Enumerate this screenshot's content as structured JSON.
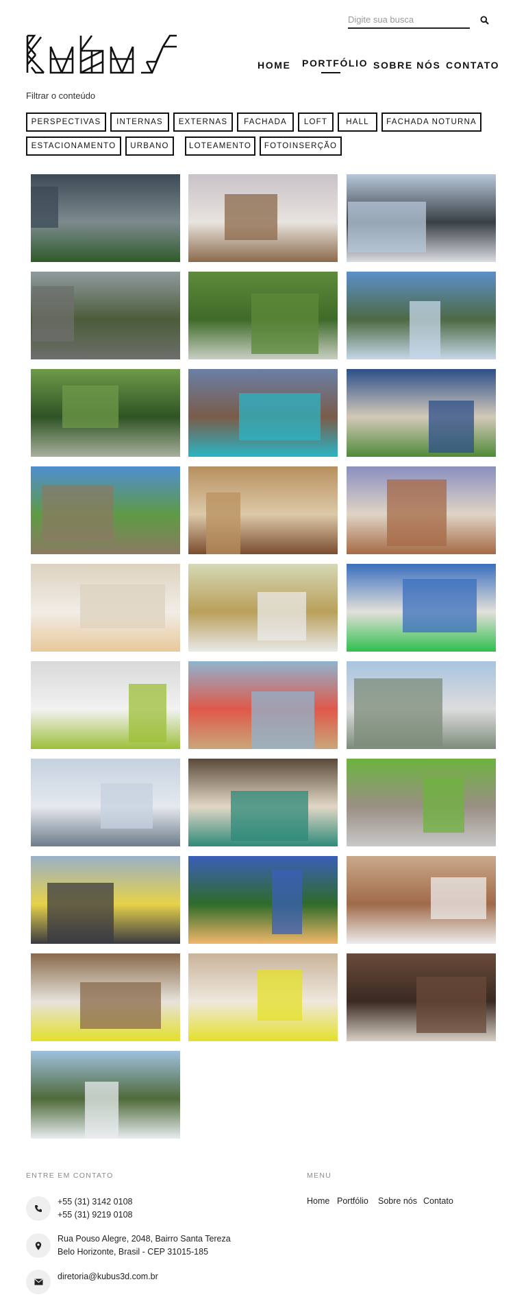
{
  "header": {
    "search_placeholder": "Digite sua busca",
    "logo_alt": "kubus",
    "nav": [
      {
        "label": "HOME"
      },
      {
        "label": "PORTFÓLIO"
      },
      {
        "label": "SOBRE NÓS"
      },
      {
        "label": "CONTATO"
      }
    ]
  },
  "filter": {
    "label": "Filtrar o conteúdo",
    "chips": [
      "PERSPECTIVAS",
      "INTERNAS",
      "EXTERNAS",
      "FACHADA",
      "LOFT",
      "HALL",
      "FACHADA NOTURNA",
      "ESTACIONAMENTO",
      "URBANO",
      "LOTEAMENTO",
      "FOTOINSERÇÃO"
    ]
  },
  "gallery": [
    {
      "scene": "exterior-night-facade",
      "colors": [
        "#3b4a55",
        "#2f5a2a",
        "#7d8a8e"
      ]
    },
    {
      "scene": "interior-loft",
      "colors": [
        "#c9c2c8",
        "#8c6a4b",
        "#e8e3de"
      ]
    },
    {
      "scene": "tower-exterior",
      "colors": [
        "#b7c8da",
        "#d9dde2",
        "#3a3f46"
      ]
    },
    {
      "scene": "street-facade",
      "colors": [
        "#8f9a9e",
        "#6d6f6c",
        "#4c5c3a"
      ]
    },
    {
      "scene": "aerial-lots",
      "colors": [
        "#5e8a3a",
        "#c9cfc3",
        "#3f6b2a"
      ]
    },
    {
      "scene": "canopy-glass",
      "colors": [
        "#5b8fc9",
        "#c5d7e8",
        "#4e6a44"
      ]
    },
    {
      "scene": "aerial-road",
      "colors": [
        "#6f9a4a",
        "#a8b09e",
        "#2f5324"
      ]
    },
    {
      "scene": "pool-house-dusk",
      "colors": [
        "#6a7fa6",
        "#2bb4c4",
        "#7a5c4a"
      ]
    },
    {
      "scene": "house-night",
      "colors": [
        "#2d4f8a",
        "#4f8a38",
        "#d3c9b8"
      ]
    },
    {
      "scene": "wall-facade",
      "colors": [
        "#4f8ed1",
        "#8a7a62",
        "#5f9a45"
      ]
    },
    {
      "scene": "hotel-lobby",
      "colors": [
        "#b8905f",
        "#7b4d2f",
        "#dcc9a8"
      ]
    },
    {
      "scene": "lobby-reception",
      "colors": [
        "#8a8fbf",
        "#a56a45",
        "#e0d4c6"
      ]
    },
    {
      "scene": "office-interior",
      "colors": [
        "#ddd2bf",
        "#e8c89a",
        "#f1ede6"
      ]
    },
    {
      "scene": "bedroom",
      "colors": [
        "#d5d8b5",
        "#e9e9e9",
        "#b9a05a"
      ]
    },
    {
      "scene": "kitchen-green",
      "colors": [
        "#3b6fbe",
        "#2fbf4e",
        "#e3e0da"
      ]
    },
    {
      "scene": "reception-white",
      "colors": [
        "#d9d9d9",
        "#9dbf3a",
        "#f2f2f2"
      ]
    },
    {
      "scene": "lobby-blue",
      "colors": [
        "#8fb4cf",
        "#c9a77a",
        "#e0584a"
      ]
    },
    {
      "scene": "street-palms",
      "colors": [
        "#a8c4e0",
        "#7c8c7a",
        "#dcdcdc"
      ]
    },
    {
      "scene": "avenue-motion",
      "colors": [
        "#c5d1e0",
        "#6d7d8c",
        "#e6e9ee"
      ]
    },
    {
      "scene": "hall-stripes",
      "colors": [
        "#5a4a3a",
        "#2e8a7a",
        "#e2d7c6"
      ]
    },
    {
      "scene": "parking-car",
      "colors": [
        "#6db33f",
        "#c8c8c8",
        "#9a8f84"
      ]
    },
    {
      "scene": "balcony-living",
      "colors": [
        "#9ab0c8",
        "#3a3a42",
        "#e6d24a"
      ]
    },
    {
      "scene": "sunset-living",
      "colors": [
        "#3b5fb8",
        "#f0b76a",
        "#2f6b2a"
      ]
    },
    {
      "scene": "loft-brick",
      "colors": [
        "#c9a98a",
        "#ececec",
        "#a06a4a"
      ]
    },
    {
      "scene": "living-yellow",
      "colors": [
        "#8a6a4a",
        "#e4e02a",
        "#e6e2dc"
      ]
    },
    {
      "scene": "bedroom-stone",
      "colors": [
        "#c8b49a",
        "#e4e02a",
        "#efe8de"
      ]
    },
    {
      "scene": "living-dark",
      "colors": [
        "#6a4a3a",
        "#d8cfc4",
        "#3a2a22"
      ]
    },
    {
      "scene": "tower-white",
      "colors": [
        "#9fc0de",
        "#e8ecef",
        "#4f6a3a"
      ]
    }
  ],
  "footer": {
    "contact_heading": "ENTRE EM CONTATO",
    "phone1": "+55 (31) 3142 0108",
    "phone2": "+55 (31) 9219 0108",
    "address1": "Rua Pouso Alegre, 2048, Bairro Santa Tereza",
    "address2": "Belo Horizonte, Brasil - CEP 31015-185",
    "email": "diretoria@kubus3d.com.br",
    "menu_heading": "MENU",
    "menu": [
      "Home",
      "Portfólio",
      "Sobre nós",
      "Contato"
    ]
  }
}
